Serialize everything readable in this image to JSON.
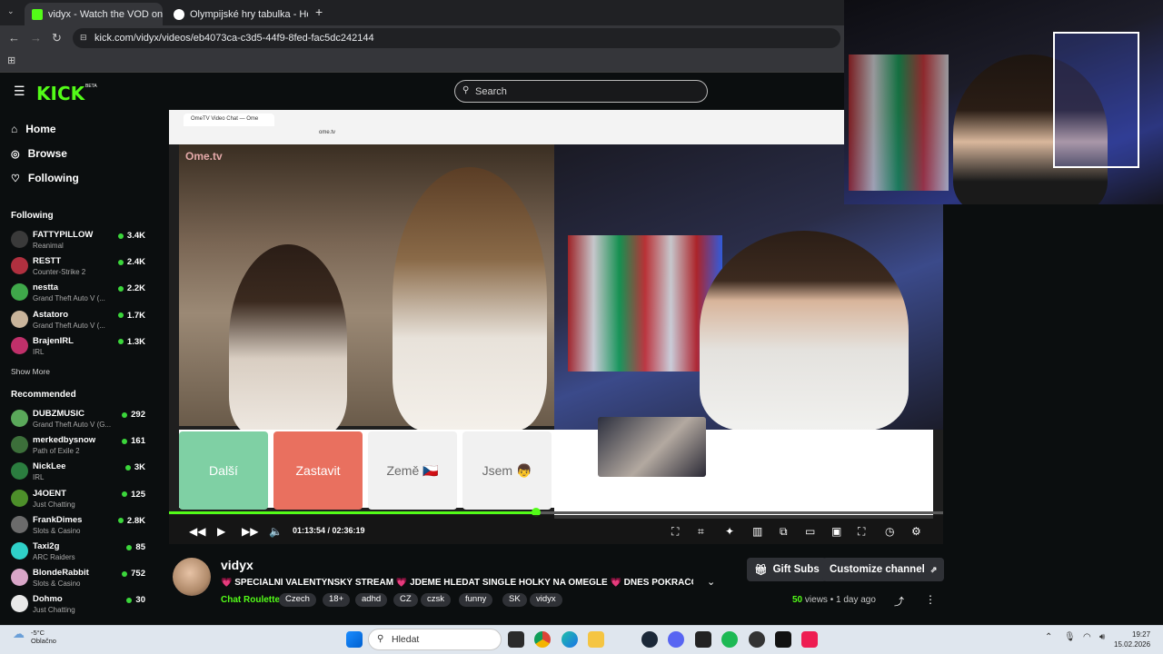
{
  "browser": {
    "tabs": [
      {
        "label": "vidyx - Watch the VOD on Kick",
        "active": true
      },
      {
        "label": "Olympijské hry tabulka - Hokej",
        "active": false
      }
    ],
    "new_tab": "+",
    "url": "kick.com/vidyx/videos/eb4073ca-c3d5-44f9-8fed-fac5dc242144"
  },
  "kick": {
    "logo": "KICK",
    "beta": "BETA",
    "search_placeholder": "Search",
    "nav": [
      {
        "label": "Home",
        "icon": "home-icon"
      },
      {
        "label": "Browse",
        "icon": "compass-icon"
      },
      {
        "label": "Following",
        "icon": "heart-icon"
      }
    ],
    "following_heading": "Following",
    "following": [
      {
        "name": "FATTYPILLOW",
        "category": "Reanimal",
        "viewers": "3.4K",
        "color": "#3a3a3a"
      },
      {
        "name": "RESTT",
        "category": "Counter-Strike 2",
        "viewers": "2.4K",
        "color": "#b0303f"
      },
      {
        "name": "nestta",
        "category": "Grand Theft Auto V (...",
        "viewers": "2.2K",
        "color": "#3fa84a"
      },
      {
        "name": "Astatoro",
        "category": "Grand Theft Auto V (...",
        "viewers": "1.7K",
        "color": "#c9b49b"
      },
      {
        "name": "BrajenIRL",
        "category": "IRL",
        "viewers": "1.3K",
        "color": "#c0306a"
      }
    ],
    "show_more": "Show More",
    "recommended_heading": "Recommended",
    "recommended": [
      {
        "name": "DUBZMUSIC",
        "category": "Grand Theft Auto V (G...",
        "viewers": "292",
        "color": "#5aa85a"
      },
      {
        "name": "merkedbysnow",
        "category": "Path of Exile 2",
        "viewers": "161",
        "color": "#3c6f3a"
      },
      {
        "name": "NickLee",
        "category": "IRL",
        "viewers": "3K",
        "color": "#2b7d3f"
      },
      {
        "name": "J4OENT",
        "category": "Just Chatting",
        "viewers": "125",
        "color": "#4d8f2a"
      },
      {
        "name": "FrankDimes",
        "category": "Slots & Casino",
        "viewers": "2.8K",
        "color": "#6b6b6b"
      },
      {
        "name": "Taxi2g",
        "category": "ARC Raiders",
        "viewers": "85",
        "color": "#2fd0c8"
      },
      {
        "name": "BlondeRabbit",
        "category": "Slots & Casino",
        "viewers": "752",
        "color": "#d9a6c8"
      },
      {
        "name": "Dohmo",
        "category": "Just Chatting",
        "viewers": "30",
        "color": "#e8e8e8"
      }
    ]
  },
  "player": {
    "inner_tab": "OmeTV Video Chat — Ome",
    "inner_url": "ome.tv",
    "ome_logo": "Ome.tv",
    "buttons": [
      {
        "label": "Další",
        "bg": "#7fd0a4",
        "fg": "#ffffff"
      },
      {
        "label": "Zastavit",
        "bg": "#e9705f",
        "fg": "#ffffff"
      },
      {
        "label": "Země 🇨🇿",
        "bg": "#f1f1f1",
        "fg": "#6b6b6b"
      },
      {
        "label": "Jsem 👦",
        "bg": "#f1f1f1",
        "fg": "#6b6b6b"
      }
    ],
    "progress": 0.474,
    "timecode": "01:13:54 / 02:36:19"
  },
  "stream": {
    "channel": "vidyx",
    "title": "💗 SPECIÁLNÍ VALENTÝNSKÝ STREAM 💗 JDEME HLEDAT SINGLE HOLKY NA OMEGLE 💗 DNES POKRAČOVÁNÍ V...",
    "category": "Chat Roulette",
    "tags": [
      "Czech",
      "18+",
      "adhd",
      "CZ",
      "czsk",
      "funny",
      "SK",
      "vidyx"
    ],
    "gift_subs": "Gift Subs",
    "customize": "Customize channel",
    "views_count": "50",
    "views_label": "views",
    "age": "1 day ago"
  },
  "taskbar": {
    "temp": "-5°C",
    "weather": "Oblačno",
    "search": "Hledat",
    "time": "19:27",
    "date": "15.02.2026"
  }
}
